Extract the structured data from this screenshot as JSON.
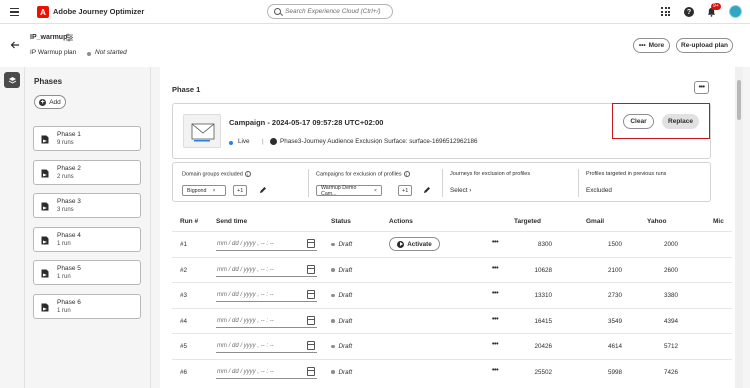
{
  "app": {
    "name": "Adobe Journey Optimizer",
    "logo_letter": "A"
  },
  "search": {
    "placeholder": "Search Experience Cloud (Ctrl+/)"
  },
  "notifications": {
    "badge": "9+"
  },
  "header": {
    "plan_name": "IP_warmup",
    "plan_type": "IP Warmup plan",
    "status": "Not started",
    "more_label": "More",
    "reupload_label": "Re-upload plan"
  },
  "phases_panel": {
    "title": "Phases",
    "add_label": "Add",
    "items": [
      {
        "name": "Phase 1",
        "runs": "9 runs"
      },
      {
        "name": "Phase 2",
        "runs": "2 runs"
      },
      {
        "name": "Phase 3",
        "runs": "3 runs"
      },
      {
        "name": "Phase 4",
        "runs": "1 run"
      },
      {
        "name": "Phase 5",
        "runs": "1 run"
      },
      {
        "name": "Phase 6",
        "runs": "1 run"
      }
    ]
  },
  "phase": {
    "title": "Phase 1",
    "more_glyph": "•••",
    "campaign": {
      "title": "Campaign - 2024-05-17 09:57:28 UTC+02:00",
      "status": "Live",
      "separator": "|",
      "journey": "Phase3-Journey Audience Exclusion",
      "surface": "Surface: surface-1696512962186",
      "clear_label": "Clear",
      "replace_label": "Replace"
    },
    "filters": {
      "domain_groups_label": "Domain groups excluded",
      "domain_groups_tag": "Bigpond",
      "domain_groups_more": "+1",
      "campaigns_label": "Campaigns for exclusion of profiles",
      "campaigns_tag": "Warmup Demo Cam...",
      "campaigns_more": "+1",
      "journeys_label": "Journeys for exclusion of profiles",
      "journeys_select": "Select",
      "profiles_label": "Profiles targeted in previous runs",
      "profiles_value": "Excluded"
    },
    "table": {
      "headers": {
        "run": "Run #",
        "send_time": "Send time",
        "status": "Status",
        "actions": "Actions",
        "targeted": "Targeted",
        "gmail": "Gmail",
        "yahoo": "Yahoo",
        "microsoft": "Mic"
      },
      "date_placeholder": "mm / dd / yyyy ,  -- : --",
      "activate_label": "Activate",
      "row_more_glyph": "•••",
      "rows": [
        {
          "run": "#1",
          "status": "Draft",
          "targeted": "8300",
          "gmail": "1500",
          "yahoo": "2000"
        },
        {
          "run": "#2",
          "status": "Draft",
          "targeted": "10628",
          "gmail": "2100",
          "yahoo": "2600"
        },
        {
          "run": "#3",
          "status": "Draft",
          "targeted": "13310",
          "gmail": "2730",
          "yahoo": "3380"
        },
        {
          "run": "#4",
          "status": "Draft",
          "targeted": "16415",
          "gmail": "3549",
          "yahoo": "4394"
        },
        {
          "run": "#5",
          "status": "Draft",
          "targeted": "20426",
          "gmail": "4614",
          "yahoo": "5712"
        },
        {
          "run": "#6",
          "status": "Draft",
          "targeted": "25502",
          "gmail": "5998",
          "yahoo": "7426"
        }
      ]
    }
  }
}
